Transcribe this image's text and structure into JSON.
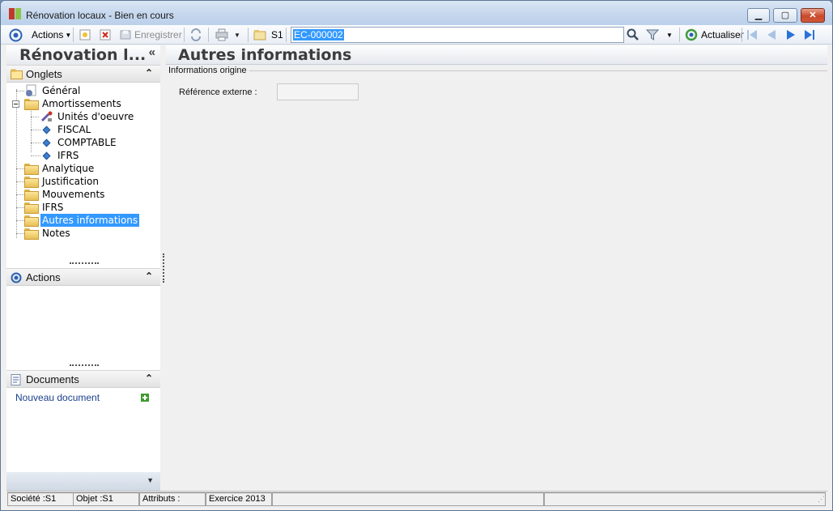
{
  "window": {
    "title": "Rénovation locaux -  Bien en cours",
    "minimize_label": "▁",
    "maximize_label": "▢",
    "close_label": "✕"
  },
  "toolbar": {
    "actions_label": "Actions",
    "save_label": "Enregistrer",
    "company_label": "S1",
    "search_value": "EC-000002",
    "refresh_label": "Actualiser"
  },
  "left_panel": {
    "title": "Rénovation l...",
    "collapse_glyph": "«",
    "sections": {
      "onglets": "Onglets",
      "actions": "Actions",
      "documents": "Documents"
    },
    "tree": [
      "Général",
      "Amortissements",
      "Unités d'oeuvre",
      "FISCAL",
      "COMPTABLE",
      "IFRS",
      "Analytique",
      "Justification",
      "Mouvements",
      "IFRS",
      "Autres informations",
      "Notes"
    ],
    "selected_tab": "Autres informations",
    "new_document_label": "Nouveau document"
  },
  "main": {
    "title": "Autres informations",
    "group_title": "Informations origine",
    "external_ref_label": "Référence externe :",
    "external_ref_value": ""
  },
  "status_bar": {
    "company": "Société :S1",
    "object": "Objet :S1",
    "attributes": "Attributs :",
    "year": "Exercice 2013"
  },
  "colors": {
    "selection": "#3399ff",
    "title_bar": "#c7d8ee",
    "panel_header_text": "#3c3c3c"
  }
}
